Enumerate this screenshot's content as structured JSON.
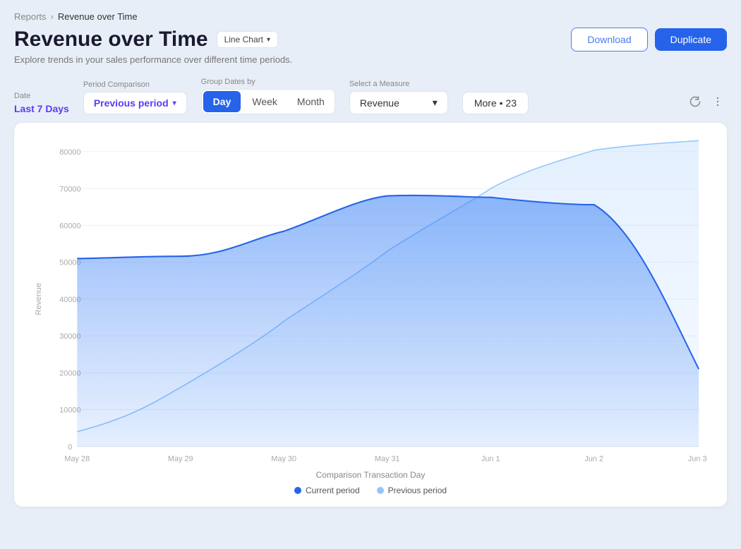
{
  "breadcrumb": {
    "parent": "Reports",
    "current": "Revenue over Time"
  },
  "header": {
    "title": "Revenue over Time",
    "chart_type": "Line Chart",
    "subtitle": "Explore trends in your sales performance over different time periods.",
    "download_label": "Download",
    "duplicate_label": "Duplicate"
  },
  "filters": {
    "date_label": "Date",
    "date_value": "Last 7 Days",
    "period_comparison_label": "Period Comparison",
    "period_comparison_value": "Previous period",
    "group_dates_label": "Group Dates by",
    "group_dates_options": [
      "Day",
      "Week",
      "Month"
    ],
    "group_dates_active": "Day",
    "measure_label": "Select a Measure",
    "measure_value": "Revenue",
    "more_label": "More",
    "more_count": "23"
  },
  "chart": {
    "y_axis_label": "Revenue",
    "x_axis_label": "Comparison Transaction Day",
    "y_ticks": [
      0,
      10000,
      20000,
      30000,
      40000,
      50000,
      60000,
      70000,
      80000
    ],
    "x_labels": [
      "May 28",
      "May 29",
      "May 30",
      "May 31",
      "Jun 1",
      "Jun 2",
      "Jun 3"
    ],
    "legend": [
      {
        "label": "Current period",
        "color": "#2563eb"
      },
      {
        "label": "Previous period",
        "color": "#93c5fd"
      }
    ]
  }
}
